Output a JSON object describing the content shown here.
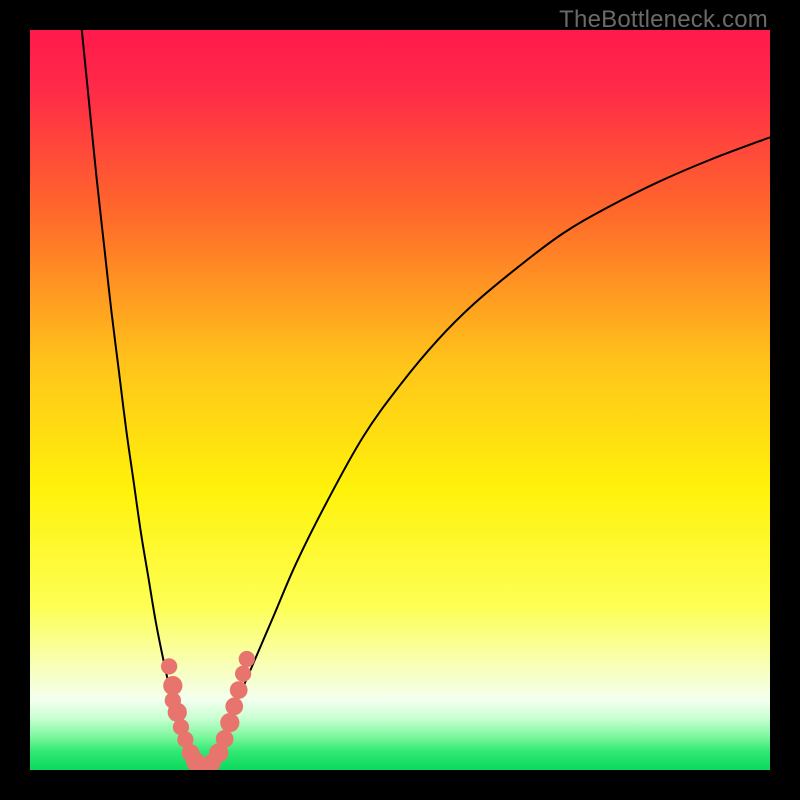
{
  "watermark": "TheBottleneck.com",
  "chart_data": {
    "type": "line",
    "title": "",
    "xlabel": "",
    "ylabel": "",
    "xlim": [
      0,
      100
    ],
    "ylim": [
      0,
      100
    ],
    "grid": false,
    "legend": null,
    "gradient_stops": [
      {
        "pos": 0.0,
        "color": "#ff1a4b"
      },
      {
        "pos": 0.08,
        "color": "#ff2a48"
      },
      {
        "pos": 0.25,
        "color": "#ff6a2a"
      },
      {
        "pos": 0.45,
        "color": "#ffc41a"
      },
      {
        "pos": 0.62,
        "color": "#fff20a"
      },
      {
        "pos": 0.78,
        "color": "#fdff55"
      },
      {
        "pos": 0.86,
        "color": "#f8ffb8"
      },
      {
        "pos": 0.905,
        "color": "#f3ffef"
      },
      {
        "pos": 0.93,
        "color": "#c9ffd1"
      },
      {
        "pos": 0.955,
        "color": "#7cf79d"
      },
      {
        "pos": 0.975,
        "color": "#31e874"
      },
      {
        "pos": 1.0,
        "color": "#0bd95e"
      }
    ],
    "series": [
      {
        "name": "left-branch",
        "x": [
          7,
          8,
          9,
          10,
          11,
          12,
          13,
          14,
          15,
          16,
          17,
          18,
          19,
          20,
          21,
          22,
          23
        ],
        "y": [
          100,
          90,
          80,
          71,
          62,
          54,
          46,
          39,
          32,
          26,
          20,
          15,
          10.5,
          6.5,
          3.5,
          1.3,
          0.2
        ]
      },
      {
        "name": "right-branch",
        "x": [
          23,
          25,
          27,
          30,
          33,
          36,
          40,
          45,
          50,
          55,
          60,
          66,
          72,
          78,
          85,
          92,
          100
        ],
        "y": [
          0.2,
          2.5,
          7,
          14,
          21,
          28,
          36,
          45,
          52,
          58,
          63,
          68,
          72.5,
          76,
          79.5,
          82.5,
          85.5
        ]
      }
    ],
    "scatter_points": [
      {
        "x": 18.8,
        "y": 14.0,
        "r": 1.1
      },
      {
        "x": 19.3,
        "y": 11.4,
        "r": 1.3
      },
      {
        "x": 19.3,
        "y": 9.4,
        "r": 1.1
      },
      {
        "x": 19.9,
        "y": 7.8,
        "r": 1.3
      },
      {
        "x": 20.4,
        "y": 5.8,
        "r": 1.1
      },
      {
        "x": 21.0,
        "y": 4.1,
        "r": 1.1
      },
      {
        "x": 21.7,
        "y": 2.3,
        "r": 1.2
      },
      {
        "x": 22.4,
        "y": 1.1,
        "r": 1.3
      },
      {
        "x": 23.0,
        "y": 0.5,
        "r": 1.2
      },
      {
        "x": 23.8,
        "y": 0.5,
        "r": 1.2
      },
      {
        "x": 24.6,
        "y": 1.0,
        "r": 1.2
      },
      {
        "x": 25.5,
        "y": 2.3,
        "r": 1.3
      },
      {
        "x": 26.3,
        "y": 4.2,
        "r": 1.2
      },
      {
        "x": 27.0,
        "y": 6.4,
        "r": 1.3
      },
      {
        "x": 27.6,
        "y": 8.6,
        "r": 1.2
      },
      {
        "x": 28.2,
        "y": 10.8,
        "r": 1.2
      },
      {
        "x": 28.8,
        "y": 13.0,
        "r": 1.1
      },
      {
        "x": 29.3,
        "y": 15.0,
        "r": 1.1
      }
    ],
    "scatter_color": "#e8756d",
    "curve_color": "#000000"
  }
}
